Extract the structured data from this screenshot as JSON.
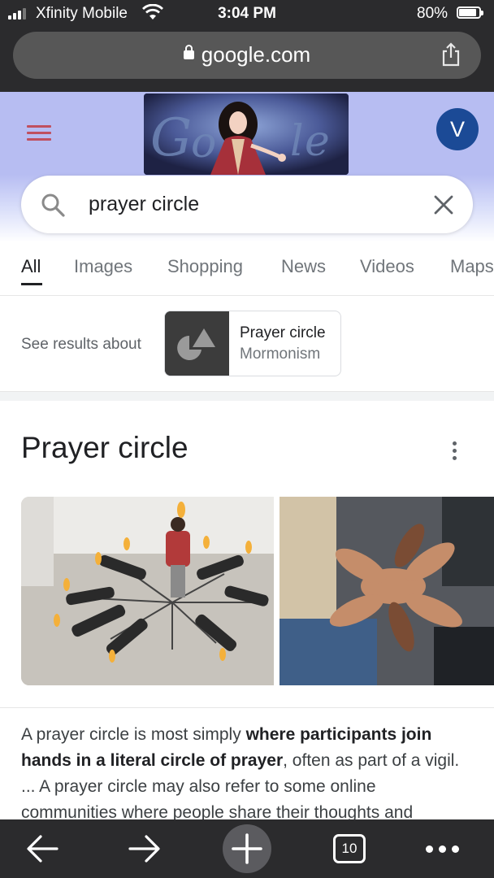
{
  "status_bar": {
    "carrier": "Xfinity Mobile",
    "time": "3:04 PM",
    "battery": "80%",
    "battery_level": 0.8
  },
  "browser": {
    "url": "google.com",
    "icons": [
      "lock-icon",
      "share-icon"
    ]
  },
  "google": {
    "avatar_letter": "V",
    "doodle_text": "Google",
    "search_query": "prayer circle"
  },
  "tabs": [
    {
      "label": "All",
      "active": true
    },
    {
      "label": "Images"
    },
    {
      "label": "Shopping"
    },
    {
      "label": "News"
    },
    {
      "label": "Videos"
    },
    {
      "label": "Maps"
    }
  ],
  "see_results": {
    "label": "See results about",
    "chip_title": "Prayer circle",
    "chip_subtitle": "Mormonism"
  },
  "knowledge_panel": {
    "title": "Prayer circle",
    "description": {
      "part1": "A prayer circle is most simply ",
      "bold1": "where participants join hands in a literal circle of prayer",
      "part2": ", often as part of a vigil. ... A prayer circle may also refer to some online communities where people share their thoughts and"
    }
  },
  "toolbar": {
    "tab_count": "10",
    "icons": [
      "back-arrow-icon",
      "forward-arrow-icon",
      "new-tab-plus-icon",
      "tabs-icon",
      "more-icon"
    ]
  },
  "colors": {
    "chrome_bg": "#2b2b2d",
    "header_bg": "#b7bdf2",
    "avatar_bg": "#1b4a96",
    "menu_icon": "#c0505f"
  }
}
